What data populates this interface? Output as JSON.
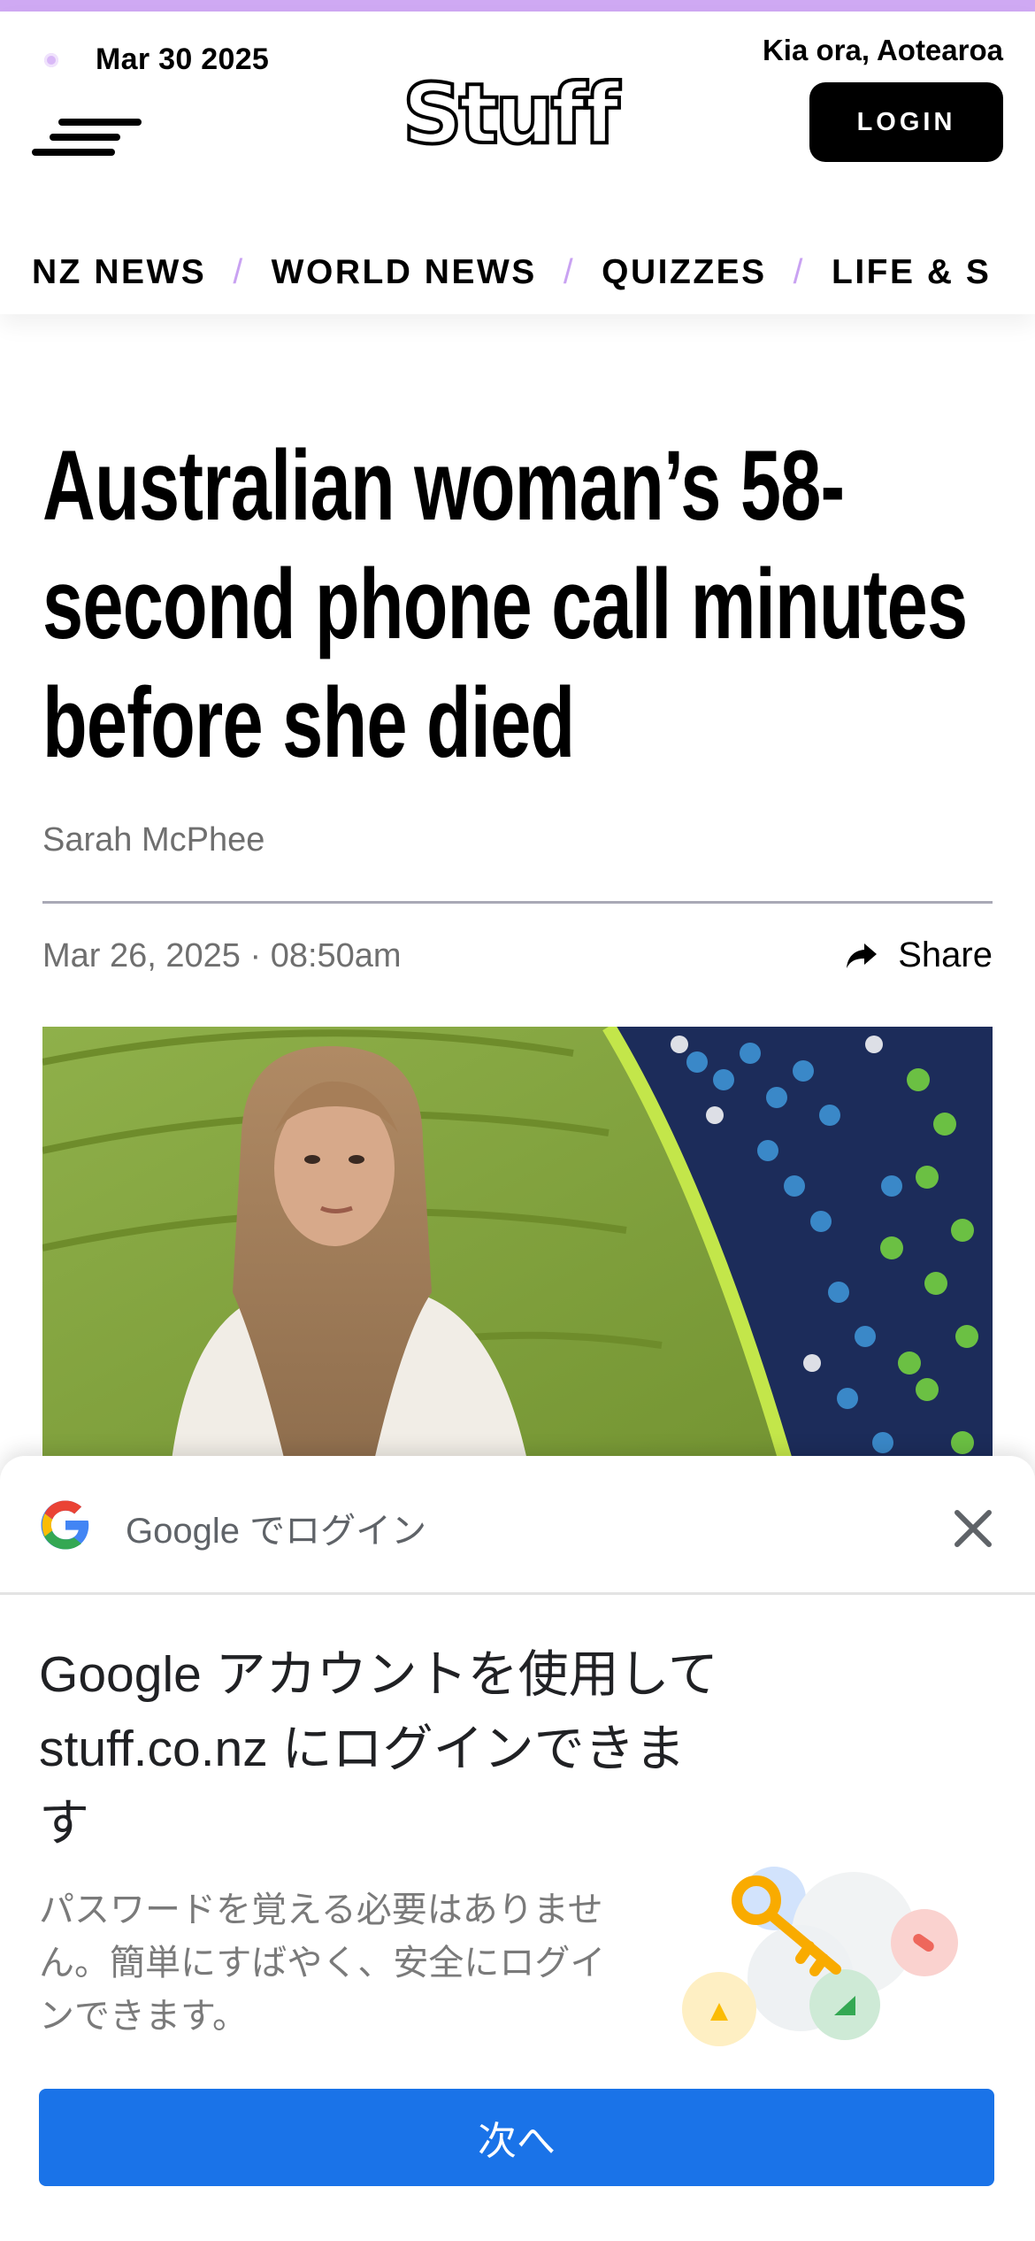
{
  "header": {
    "date": "Mar 30 2025",
    "greeting": "Kia ora, Aotearoa",
    "logo": "Stuff",
    "login_label": "LOGIN",
    "nav": [
      "NZ NEWS",
      "WORLD NEWS",
      "QUIZZES",
      "LIFE & S"
    ],
    "nav_separator": "/"
  },
  "article": {
    "headline": "Australian woman’s 58-second phone call minutes before she died",
    "author": "Sarah McPhee",
    "published": "Mar 26, 2025 · 08:50am",
    "share_label": "Share"
  },
  "google_signin": {
    "title": "Google でログイン",
    "heading": "Google アカウントを使用して stuff.co.nz にログインできます",
    "subtext": "パスワードを覚える必要はありません。簡単にすばやく、安全にログインできます。",
    "next_label": "次へ"
  },
  "colors": {
    "accent_purple": "#cfa9f3",
    "google_blue": "#1a73e8"
  }
}
